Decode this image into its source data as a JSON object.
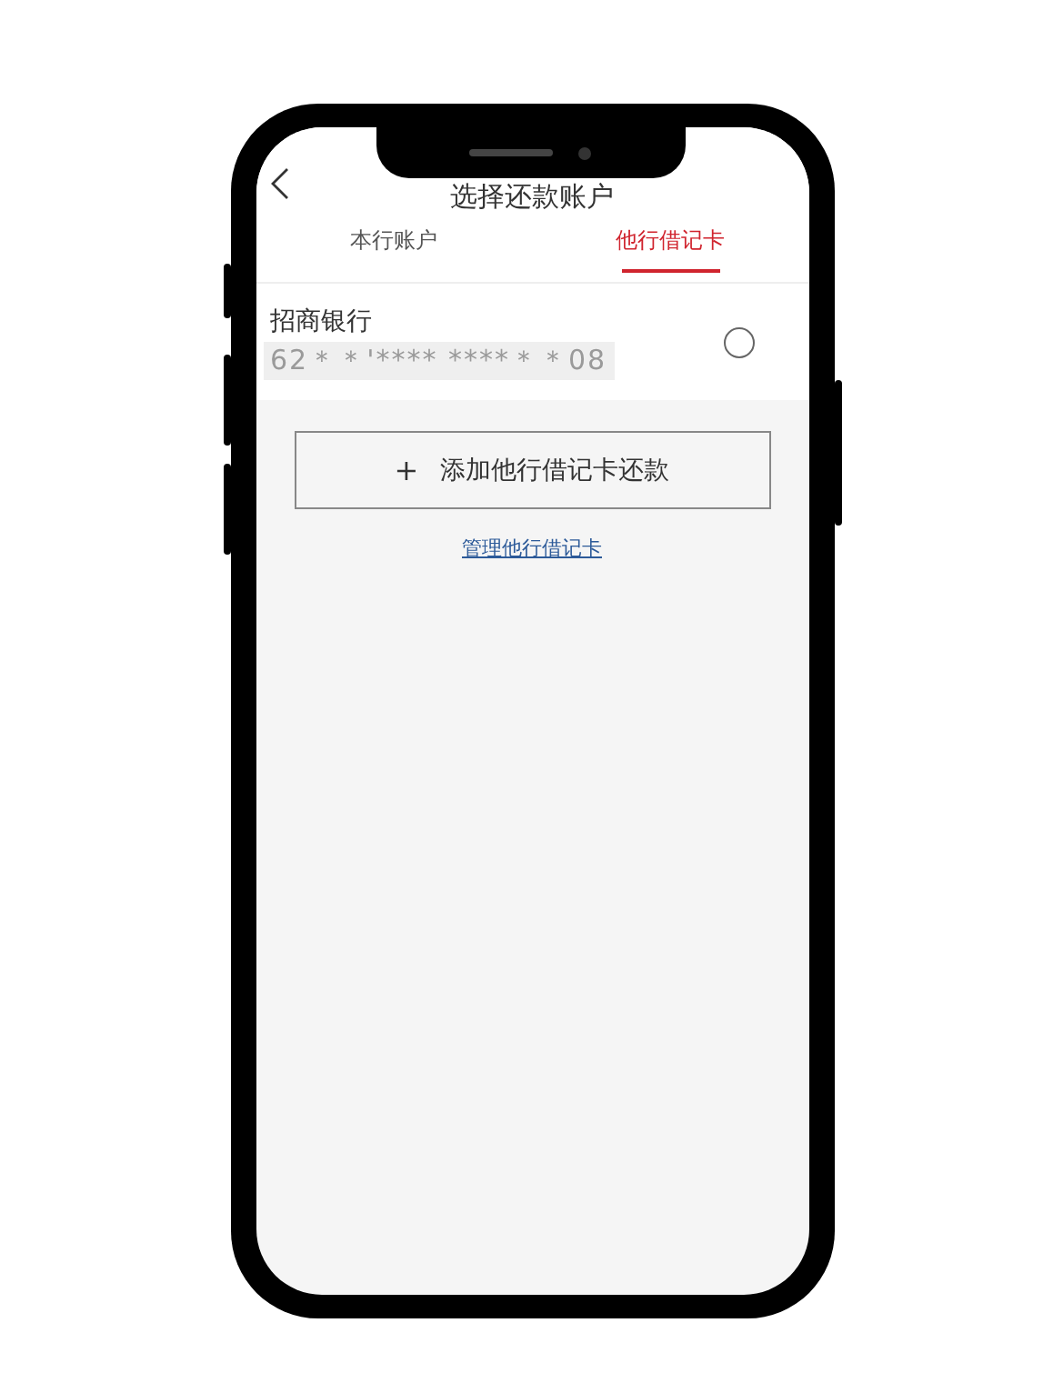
{
  "nav": {
    "title": "选择还款账户"
  },
  "tabs": [
    {
      "label": "本行账户",
      "selected": false
    },
    {
      "label": "他行借记卡",
      "selected": true
    }
  ],
  "cards": [
    {
      "bank": "招商银行",
      "number": "62＊＊'**** ****＊＊08",
      "selected": false
    }
  ],
  "add_button": {
    "icon": "+",
    "label": "添加他行借记卡还款"
  },
  "manage_link": "管理他行借记卡"
}
